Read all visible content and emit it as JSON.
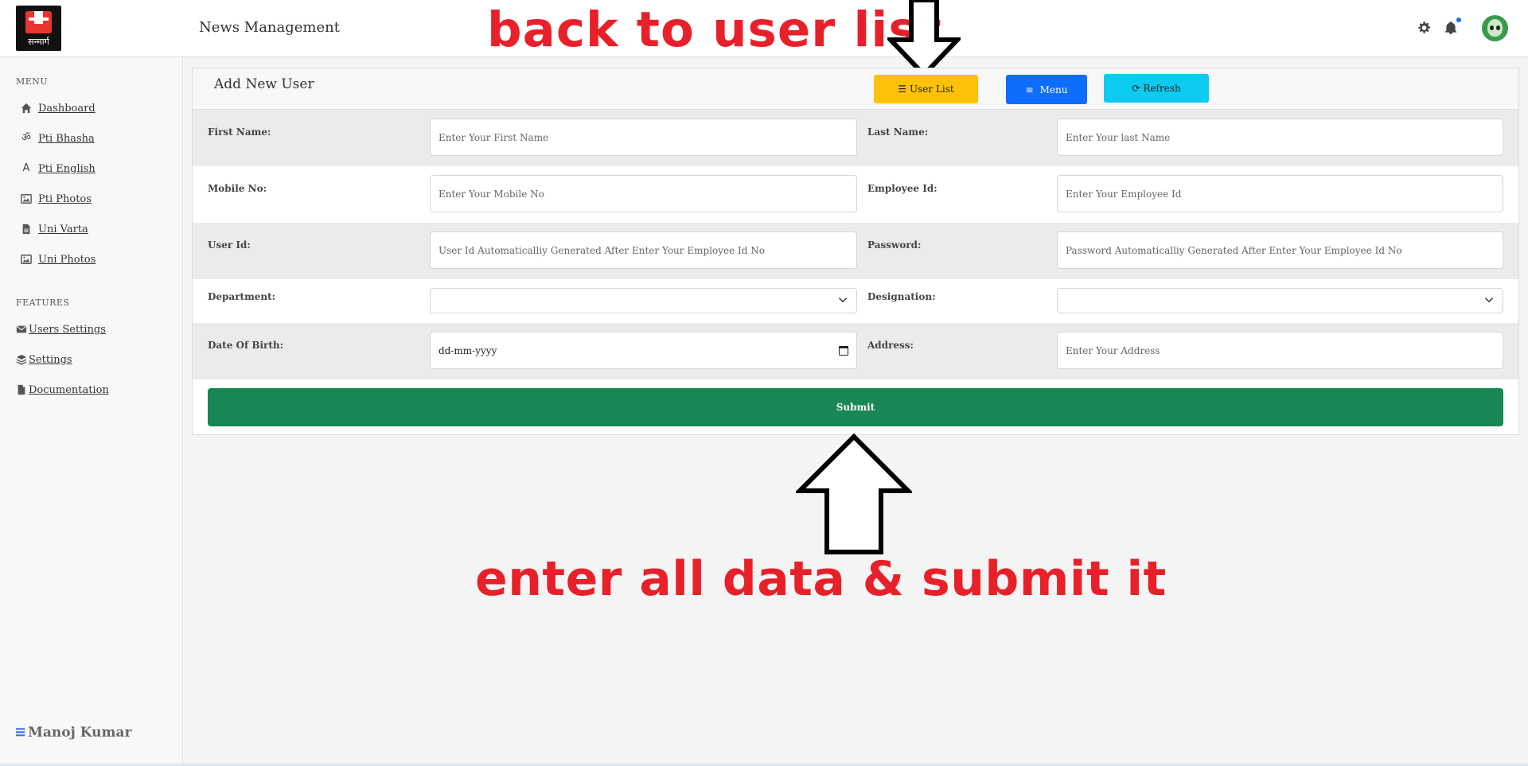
{
  "header": {
    "logo_text": "सन्मार्ग",
    "app_title": "News Management",
    "icons": [
      "gear-icon",
      "bell-icon",
      "avatar"
    ],
    "notification_dot_color": "#1a73e8"
  },
  "annotations": {
    "top": "back to user list",
    "bottom": "enter all data & submit it",
    "color": "#e8202a"
  },
  "sidebar": {
    "menu_title": "MENU",
    "menu_items": [
      {
        "label": "Dashboard",
        "icon": "home-icon"
      },
      {
        "label": "Pti Bhasha",
        "icon": "om-icon"
      },
      {
        "label": "Pti English",
        "icon": "font-icon"
      },
      {
        "label": "Pti Photos",
        "icon": "image-icon"
      },
      {
        "label": "Uni Varta",
        "icon": "file-icon"
      },
      {
        "label": "Uni Photos",
        "icon": "image-icon"
      }
    ],
    "features_title": "FEATURES",
    "feature_items": [
      {
        "label": "Users Settings",
        "icon": "envelope-icon"
      },
      {
        "label": "Settings",
        "icon": "layers-icon"
      },
      {
        "label": "Documentation",
        "icon": "document-icon"
      }
    ],
    "user_name": "Manoj Kumar"
  },
  "form": {
    "title": "Add New User",
    "buttons": {
      "user_list": "User List",
      "menu": "Menu",
      "refresh": "Refresh"
    },
    "button_colors": {
      "user_list": "#ffc107",
      "menu": "#0d6efd",
      "refresh": "#0dcaf0",
      "submit": "#198754"
    },
    "first_name": {
      "label": "First Name:",
      "placeholder": "Enter Your First Name",
      "value": ""
    },
    "last_name": {
      "label": "Last Name:",
      "placeholder": "Enter Your last Name",
      "value": ""
    },
    "mobile_no": {
      "label": "Mobile No:",
      "placeholder": "Enter Your Mobile No",
      "value": ""
    },
    "employee_id": {
      "label": "Employee Id:",
      "placeholder": "Enter Your Employee Id",
      "value": ""
    },
    "user_id": {
      "label": "User Id:",
      "placeholder": "User Id Automaticalliy Generated After Enter Your Employee Id No",
      "value": ""
    },
    "password": {
      "label": "Password:",
      "placeholder": "Password Automaticalliy Generated After Enter Your Employee Id No",
      "value": ""
    },
    "department": {
      "label": "Department:",
      "selected": ""
    },
    "designation": {
      "label": "Designation:",
      "selected": ""
    },
    "dob": {
      "label": "Date Of Birth:",
      "value": "dd-mm-yyyy"
    },
    "address": {
      "label": "Address:",
      "placeholder": "Enter Your Address",
      "value": ""
    },
    "submit": "Submit"
  }
}
